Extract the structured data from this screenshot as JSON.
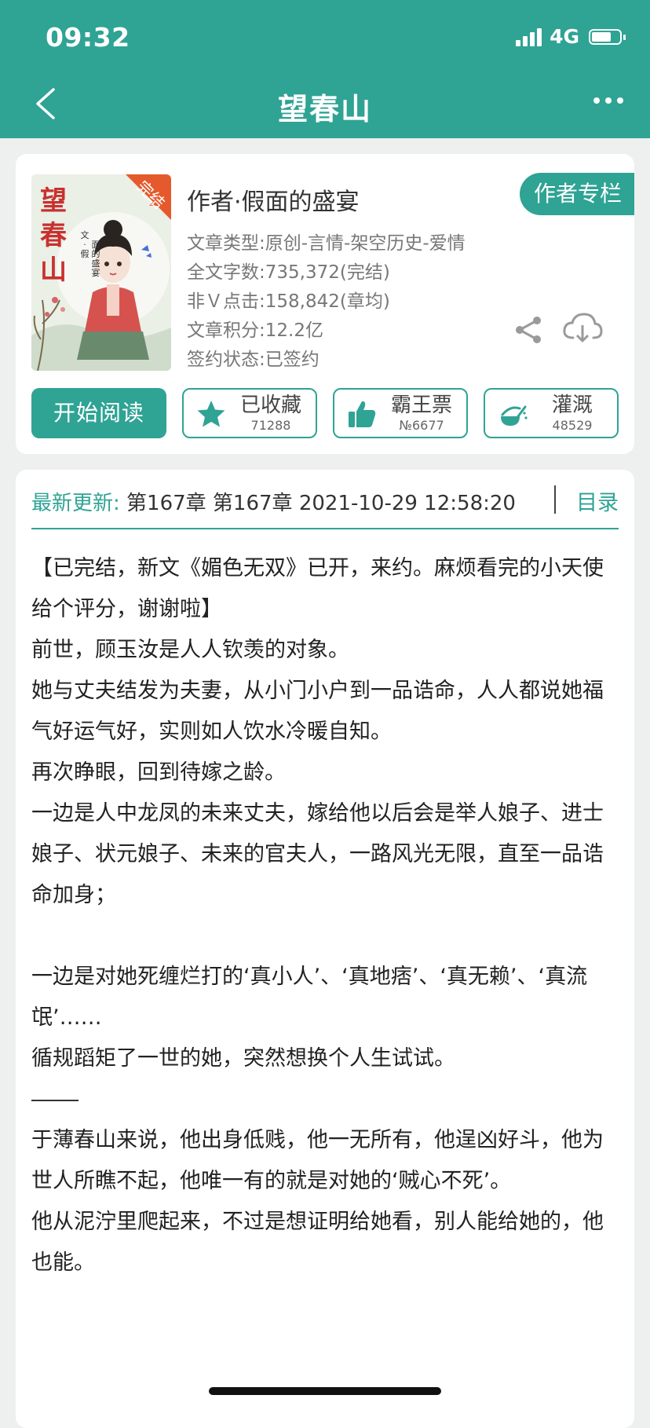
{
  "status_bar": {
    "time": "09:32",
    "network": "4G",
    "battery_level": 0.62
  },
  "nav": {
    "title": "望春山"
  },
  "book": {
    "cover": {
      "title_chars": [
        "望",
        "春",
        "山"
      ],
      "badge": "完结",
      "subtitle_chars": [
        "文",
        "·",
        "假",
        "面",
        "的",
        "盛",
        "宴"
      ]
    },
    "author_line": "作者·假面的盛宴",
    "author_column_button": "作者专栏",
    "meta": [
      "文章类型:原创-言情-架空历史-爱情",
      "全文字数:735,372(完结)",
      "非Ｖ点击:158,842(章均)",
      "文章积分:12.2亿",
      "签约状态:已签约"
    ],
    "actions": {
      "read": "开始阅读",
      "favorite": {
        "label": "已收藏",
        "count": "71288"
      },
      "vote": {
        "label": "霸王票",
        "count": "№6677"
      },
      "water": {
        "label": "灌溉",
        "count": "48529"
      }
    }
  },
  "latest_update": {
    "label": "最新更新:",
    "text": "第167章 第167章 2021-10-29 12:58:20",
    "toc": "目录"
  },
  "intro": {
    "p1": "【已完结，新文《媚色无双》已开，来约。麻烦看完的小天使给个评分，谢谢啦】",
    "p2": "前世，顾玉汝是人人钦羡的对象。",
    "p3": "她与丈夫结发为夫妻，从小门小户到一品诰命，人人都说她福气好运气好，实则如人饮水冷暖自知。",
    "p4": "再次睁眼，回到待嫁之龄。",
    "p5": "一边是人中龙凤的未来丈夫，嫁给他以后会是举人娘子、进士娘子、状元娘子、未来的官夫人，一路风光无限，直至一品诰命加身；",
    "p6": "一边是对她死缠烂打的‘真小人’、‘真地痞’、‘真无赖’、‘真流氓’……",
    "p7": "循规蹈矩了一世的她，突然想换个人生试试。",
    "p8": "于薄春山来说，他出身低贱，他一无所有，他逞凶好斗，他为世人所瞧不起，他唯一有的就是对她的‘贼心不死’。",
    "p9": "他从泥泞里爬起来，不过是想证明给她看，别人能给她的，他也能。"
  },
  "colors": {
    "accent": "#2fa394",
    "background": "#eef0ef"
  },
  "icons": [
    "back-arrow-icon",
    "more-dots-icon",
    "share-icon",
    "download-cloud-icon",
    "star-icon",
    "thumbs-up-icon",
    "watering-can-icon"
  ]
}
